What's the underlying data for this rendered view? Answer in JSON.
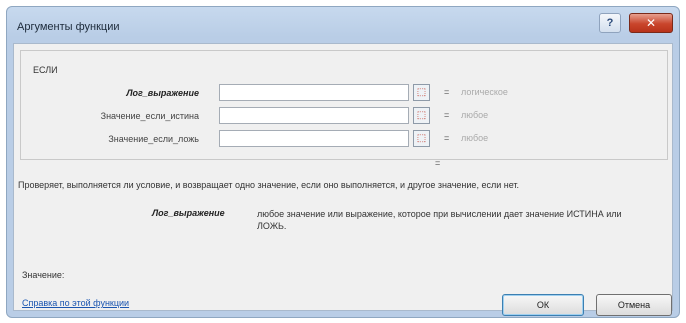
{
  "window": {
    "title": "Аргументы функции",
    "help_glyph": "?",
    "close_glyph": "✕"
  },
  "function": {
    "name": "ЕСЛИ",
    "args": [
      {
        "label": "Лог_выражение",
        "value": "",
        "result": "логическое"
      },
      {
        "label": "Значение_если_истина",
        "value": "",
        "result": "любое"
      },
      {
        "label": "Значение_если_ложь",
        "value": "",
        "result": "любое"
      }
    ],
    "equals": "=",
    "description": "Проверяет, выполняется ли условие, и возвращает одно значение, если оно выполняется, и другое значение, если нет.",
    "arg_desc_name": "Лог_выражение",
    "arg_desc_text": "любое значение или выражение, которое при вычислении дает значение ИСТИНА или ЛОЖЬ."
  },
  "footer": {
    "value_label": "Значение:",
    "help_link": "Справка по этой функции",
    "ok_label": "ОК",
    "cancel_label": "Отмена"
  },
  "icons": {
    "ref_icon": "range-select-icon"
  },
  "colors": {
    "link": "#1a55b0",
    "close": "#c9452c"
  }
}
